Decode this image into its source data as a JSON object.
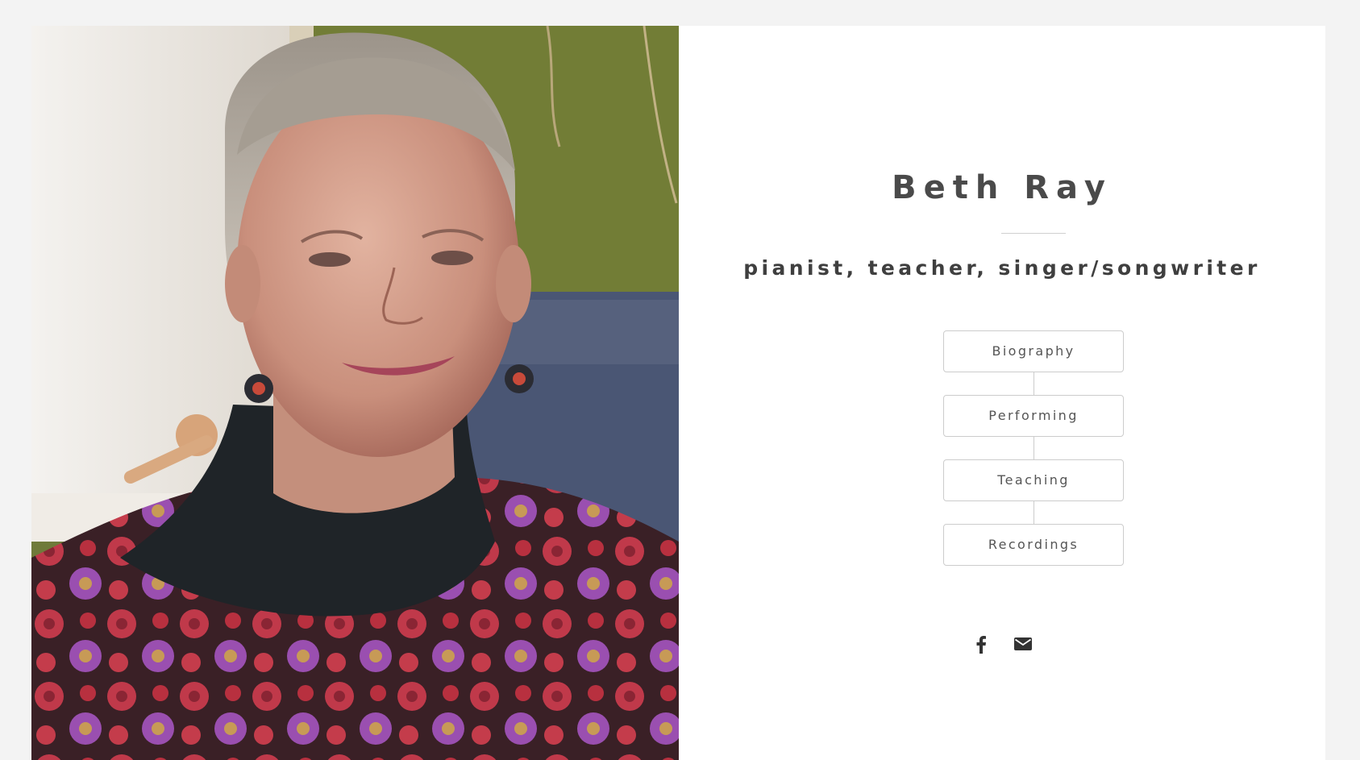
{
  "site": {
    "title": "Beth Ray",
    "tagline": "pianist, teacher, singer/songwriter"
  },
  "nav": {
    "items": [
      {
        "label": "Biography"
      },
      {
        "label": "Performing"
      },
      {
        "label": "Teaching"
      },
      {
        "label": "Recordings"
      }
    ]
  },
  "social": {
    "icons": [
      "facebook-icon",
      "email-icon"
    ]
  },
  "colors": {
    "background": "#f3f3f3",
    "panel": "#ffffff",
    "title": "#4a4a4a",
    "button_border": "#cccccc",
    "button_text": "#555555"
  }
}
